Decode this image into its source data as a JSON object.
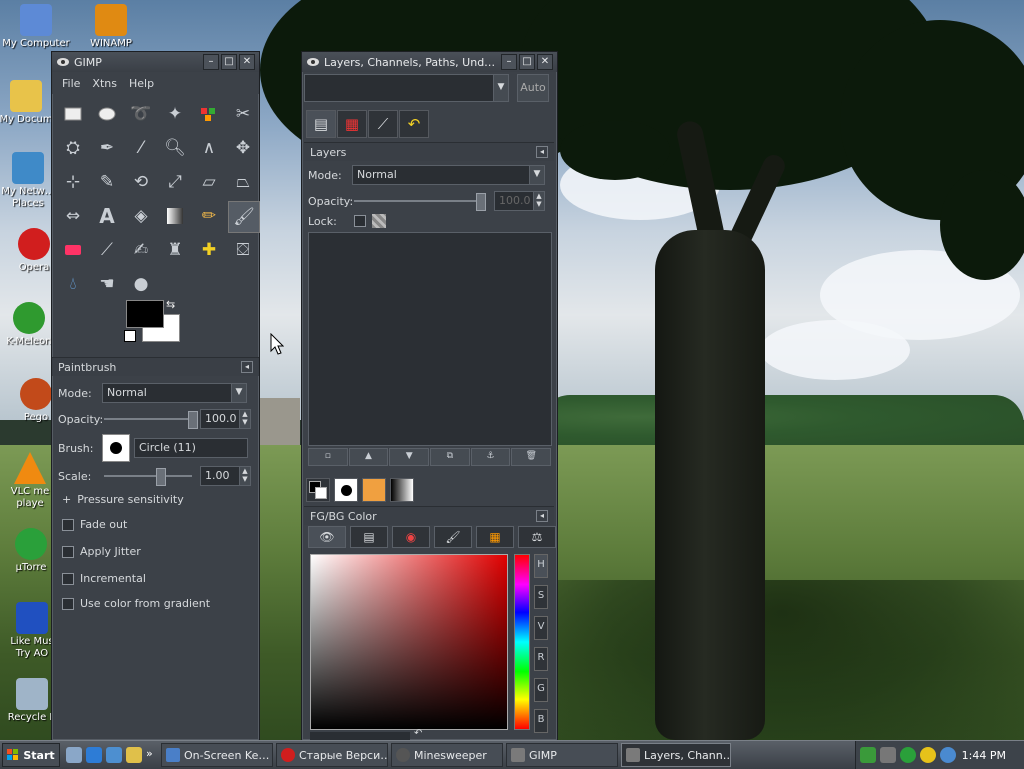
{
  "desktop": {
    "icons": [
      {
        "label": "My Computer",
        "icon": "computer-icon",
        "color": "#5d8ad6"
      },
      {
        "label": "WINAMP",
        "icon": "winamp-icon",
        "color": "#e08a12"
      },
      {
        "label": "My Docum",
        "icon": "folder-icon",
        "color": "#e8c34a"
      },
      {
        "label": "My Netw…",
        "label2": "Places",
        "icon": "network-icon",
        "color": "#3f8ac8"
      },
      {
        "label": "Opera",
        "icon": "opera-icon",
        "color": "#d11e1e"
      },
      {
        "label": "K-Meleon",
        "icon": "kmeleon-icon",
        "color": "#2f9a2f"
      },
      {
        "label": "Pego",
        "icon": "pegasus-icon",
        "color": "#c24a1a"
      },
      {
        "label": "VLC me",
        "label2": "playe",
        "icon": "vlc-icon",
        "color": "#f08a10"
      },
      {
        "label": "µTorre",
        "icon": "utorrent-icon",
        "color": "#2aa03a"
      },
      {
        "label": "Like Mus",
        "label2": "Try AO",
        "icon": "music-icon",
        "color": "#2050c0"
      },
      {
        "label": "Recycle B",
        "icon": "recycle-bin-icon",
        "color": "#9fb4c8"
      }
    ]
  },
  "gimp": {
    "title": "GIMP",
    "menu": [
      "File",
      "Xtns",
      "Help"
    ],
    "tool_options": {
      "header": "Paintbrush",
      "mode_label": "Mode:",
      "mode_value": "Normal",
      "opacity_label": "Opacity:",
      "opacity_value": "100.0",
      "opacity_fraction": 1.0,
      "brush_label": "Brush:",
      "brush_value": "Circle (11)",
      "scale_label": "Scale:",
      "scale_value": "1.00",
      "pressure_label": "Pressure sensitivity",
      "checks": [
        "Fade out",
        "Apply Jitter",
        "Incremental",
        "Use color from gradient"
      ]
    },
    "colors": {
      "fg": "#000000",
      "bg": "#ffffff"
    }
  },
  "layers": {
    "title": "Layers, Channels, Paths, Und…",
    "auto_label": "Auto",
    "layers_header": "Layers",
    "mode_label": "Mode:",
    "mode_value": "Normal",
    "opacity_label": "Opacity:",
    "opacity_value": "100.0",
    "lock_label": "Lock:",
    "fgbg_header": "FG/BG Color",
    "hsv_buttons": [
      "H",
      "S",
      "V",
      "R",
      "G",
      "B"
    ]
  },
  "taskbar": {
    "start_label": "Start",
    "tasks": [
      {
        "label": "On-Screen Ke…",
        "color": "#4a7fc8",
        "active": false
      },
      {
        "label": "Старые Верси…",
        "color": "#d11e1e",
        "active": false
      },
      {
        "label": "Minesweeper",
        "color": "#555555",
        "active": false
      },
      {
        "label": "GIMP",
        "color": "#7a7a7a",
        "active": false
      },
      {
        "label": "Layers, Chann…",
        "color": "#7a7a7a",
        "active": true
      }
    ],
    "clock": "1:44 PM"
  }
}
